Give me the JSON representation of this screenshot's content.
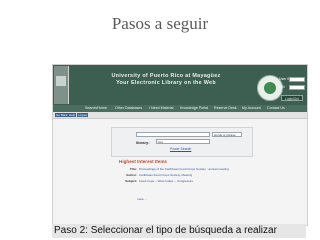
{
  "slide": {
    "title": "Pasos a seguir",
    "caption": "Paso 2: Seleccionar el tipo de búsqueda a realizar"
  },
  "banner": {
    "title_line1": "University of Puerto Rico at Mayagüez",
    "title_line2": "Your Electronic Library on the Web",
    "login_labels": [
      "User ID",
      "PIN"
    ],
    "login_button": "Login/Out"
  },
  "nav": {
    "items": [
      "Search/Home",
      "Other Databases",
      "I Need Material",
      "Knowledge Portal",
      "Reserve Desk",
      "My Account",
      "Contact Us"
    ]
  },
  "toolbar": {
    "items": [
      "Go Back",
      "Help",
      "Logout"
    ]
  },
  "search": {
    "mode_value": "words or phrase",
    "library_label": "library:",
    "library_value": "ALL",
    "power_search": "Power Search"
  },
  "highlights": {
    "heading": "Highest Interest Items",
    "rows": [
      {
        "key": "Title:",
        "value": "Proceedings of the Caribbean Food Crops Society : annual meeting"
      },
      {
        "key": "Author:",
        "value": "Caribbean Food Crops Society. Meeting"
      },
      {
        "key": "Subject:",
        "value": "Food crops -- West Indies -- Congresses"
      }
    ],
    "more": "more ..."
  },
  "colors": {
    "banner_bg": "#3d5f52",
    "nav_bg": "#4a6d60",
    "highlight_heading": "#c5462e",
    "link": "#2a55a0"
  }
}
